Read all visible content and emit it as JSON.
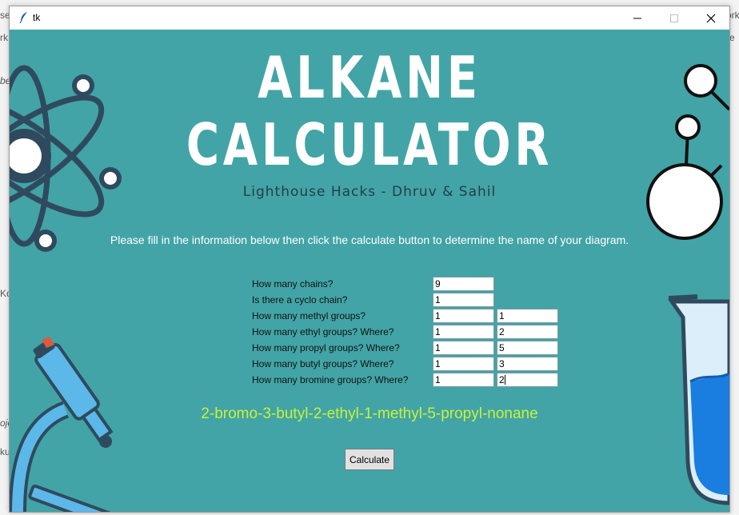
{
  "window": {
    "title": "tk",
    "background": "#42a4a6",
    "controls": {
      "minimize": "minimize-icon",
      "maximize": "maximize-icon",
      "close": "close-icon"
    }
  },
  "background_fragments": [
    "se",
    "rk",
    "be",
    "Ko",
    "ojo",
    "ku",
    "ork",
    "e"
  ],
  "header": {
    "title_line1": "ALKANE",
    "title_line2": "CALCULATOR",
    "subtitle": "Lighthouse Hacks - Dhruv & Sahil"
  },
  "instructions": "Please fill in the information below then click the calculate button to determine the name of your diagram.",
  "form": {
    "rows": [
      {
        "label": "How many chains?",
        "value": "9",
        "where": null
      },
      {
        "label": "Is there a cyclo chain?",
        "value": "1",
        "where": null
      },
      {
        "label": "How many methyl groups?",
        "value": "1",
        "where": "1"
      },
      {
        "label": "How many ethyl groups? Where?",
        "value": "1",
        "where": "2"
      },
      {
        "label": "How many propyl groups? Where?",
        "value": "1",
        "where": "5"
      },
      {
        "label": "How many butyl groups? Where?",
        "value": "1",
        "where": "3"
      },
      {
        "label": "How many bromine groups? Where?",
        "value": "1",
        "where": "2"
      }
    ]
  },
  "result": "2-bromo-3-butyl-2-ethyl-1-methyl-5-propyl-nonane",
  "calculate_label": "Calculate",
  "colors": {
    "canvas": "#42a4a6",
    "title_text": "#ffffff",
    "subtitle_text": "#263d4a",
    "result_text": "#c8f23a",
    "illustration_dark": "#2f4a5e",
    "flask_liquid": "#1a7de0"
  },
  "icons": [
    "atom-icon",
    "molecule-icon",
    "microscope-icon",
    "flask-icon",
    "feather-icon"
  ]
}
